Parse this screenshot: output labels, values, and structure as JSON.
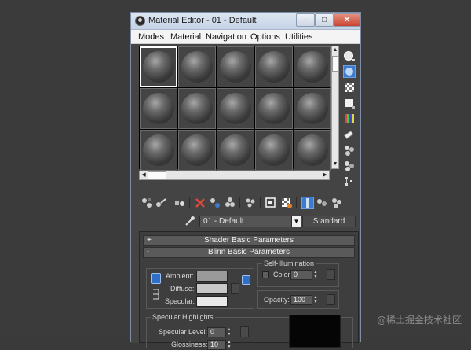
{
  "window": {
    "title": "Material Editor - 01 - Default",
    "controls": {
      "minimize": "–",
      "maximize": "□",
      "close": "✕"
    }
  },
  "menu": [
    "Modes",
    "Material",
    "Navigation",
    "Options",
    "Utilities"
  ],
  "slot_grid": {
    "columns": 5,
    "rows": 3,
    "selected_index": 0
  },
  "side_tools": [
    "sample-type-icon",
    "backlight-icon",
    "background-checker-icon",
    "sample-uv-tiling-icon",
    "video-color-check-icon",
    "make-preview-icon",
    "options-icon",
    "select-by-material-icon",
    "material-map-navigator-icon"
  ],
  "bottom_tools": [
    "get-material-icon",
    "put-to-scene-icon",
    "assign-to-selection-icon",
    "reset-map-icon",
    "make-unique-icon",
    "put-to-library-icon",
    "material-id-channel-icon",
    "show-shaded-in-viewport-icon",
    "show-end-result-icon",
    "go-to-parent-icon",
    "go-forward-to-sibling-icon"
  ],
  "material": {
    "name": "01 - Default",
    "type": "Standard"
  },
  "rollouts": {
    "shader": "Shader Basic Parameters",
    "blinn": "Blinn Basic Parameters",
    "shader_sign": "+",
    "blinn_sign": "-"
  },
  "blinn": {
    "ambient_label": "Ambient:",
    "diffuse_label": "Diffuse:",
    "specular_label": "Specular:",
    "self_illum_group": "Self-Illumination",
    "color_label": "Color",
    "color_value": "0",
    "opacity_label": "Opacity:",
    "opacity_value": "100",
    "spec_group": "Specular Highlights",
    "spec_level_label": "Specular Level:",
    "spec_level_value": "0",
    "gloss_label": "Glossiness:",
    "gloss_value": "10"
  },
  "colors": {
    "ambient": "#9a9a9a",
    "diffuse": "#c8c8c8",
    "specular": "#e9e9e9",
    "accent": "#2f6fc7"
  },
  "watermark": "@稀土掘金技术社区"
}
